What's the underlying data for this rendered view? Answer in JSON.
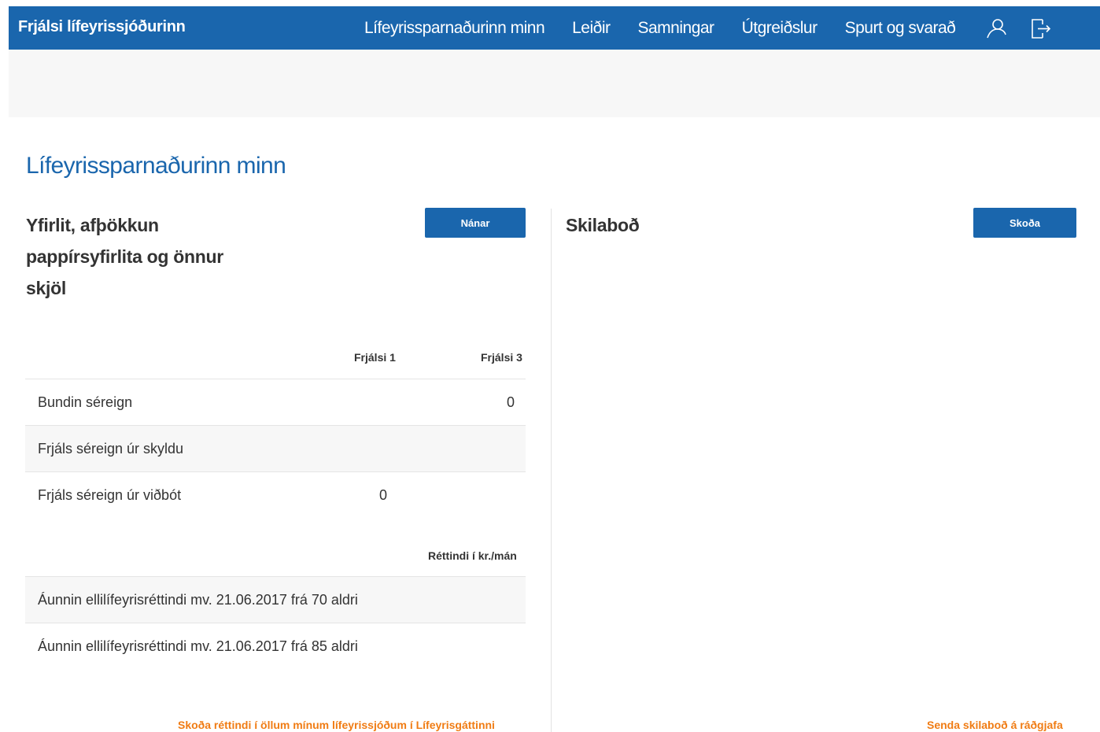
{
  "header": {
    "brand": "Frjálsi lífeyrissjóðurinn",
    "nav": [
      {
        "label": "Lífeyrissparnaðurinn minn"
      },
      {
        "label": "Leiðir"
      },
      {
        "label": "Samningar"
      },
      {
        "label": "Útgreiðslur"
      },
      {
        "label": "Spurt og svarað"
      }
    ],
    "icons": [
      "user-icon",
      "logout-icon"
    ]
  },
  "page": {
    "title": "Lífeyrissparnaðurinn minn"
  },
  "overview": {
    "title_lines": [
      "Yfirlit, afþökkun",
      "pappírsyfirlita og önnur",
      "skjöl"
    ],
    "button": "Nánar",
    "columns": [
      "Frjálsi 1",
      "Frjálsi 3"
    ],
    "rows": [
      {
        "label": "Bundin séreign",
        "frjalsi1": "",
        "frjalsi3": "0"
      },
      {
        "label": "Frjáls séreign úr skyldu",
        "frjalsi1": "",
        "frjalsi3": ""
      },
      {
        "label": "Frjáls séreign úr viðbót",
        "frjalsi1": "0",
        "frjalsi3": ""
      }
    ],
    "rights_header": "Réttindi í kr./mán",
    "rights_rows": [
      {
        "label": "Áunnin ellilífeyrisréttindi mv. 21.06.2017 frá 70 aldri",
        "value": ""
      },
      {
        "label": "Áunnin ellilífeyrisréttindi mv. 21.06.2017 frá 85 aldri",
        "value": ""
      }
    ],
    "link": "Skoða réttindi í öllum mínum lífeyrissjóðum í Lífeyrisgáttinni"
  },
  "messages": {
    "title": "Skilaboð",
    "button": "Skoða",
    "link": "Senda skilaboð á ráðgjafa"
  },
  "colors": {
    "primary": "#1a66ad",
    "accent": "#f07c14",
    "band": "#f7f7f7"
  }
}
